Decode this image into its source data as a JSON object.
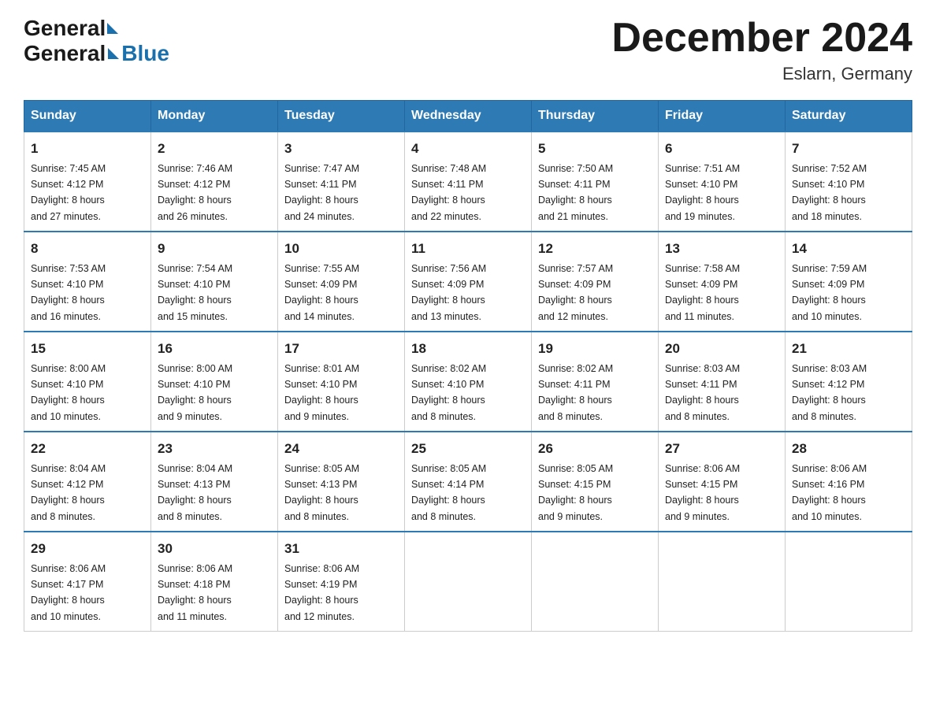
{
  "header": {
    "logo_general": "General",
    "logo_blue": "Blue",
    "month_title": "December 2024",
    "location": "Eslarn, Germany"
  },
  "days_of_week": [
    "Sunday",
    "Monday",
    "Tuesday",
    "Wednesday",
    "Thursday",
    "Friday",
    "Saturday"
  ],
  "weeks": [
    [
      {
        "day": "1",
        "sunrise": "7:45 AM",
        "sunset": "4:12 PM",
        "daylight": "8 hours and 27 minutes."
      },
      {
        "day": "2",
        "sunrise": "7:46 AM",
        "sunset": "4:12 PM",
        "daylight": "8 hours and 26 minutes."
      },
      {
        "day": "3",
        "sunrise": "7:47 AM",
        "sunset": "4:11 PM",
        "daylight": "8 hours and 24 minutes."
      },
      {
        "day": "4",
        "sunrise": "7:48 AM",
        "sunset": "4:11 PM",
        "daylight": "8 hours and 22 minutes."
      },
      {
        "day": "5",
        "sunrise": "7:50 AM",
        "sunset": "4:11 PM",
        "daylight": "8 hours and 21 minutes."
      },
      {
        "day": "6",
        "sunrise": "7:51 AM",
        "sunset": "4:10 PM",
        "daylight": "8 hours and 19 minutes."
      },
      {
        "day": "7",
        "sunrise": "7:52 AM",
        "sunset": "4:10 PM",
        "daylight": "8 hours and 18 minutes."
      }
    ],
    [
      {
        "day": "8",
        "sunrise": "7:53 AM",
        "sunset": "4:10 PM",
        "daylight": "8 hours and 16 minutes."
      },
      {
        "day": "9",
        "sunrise": "7:54 AM",
        "sunset": "4:10 PM",
        "daylight": "8 hours and 15 minutes."
      },
      {
        "day": "10",
        "sunrise": "7:55 AM",
        "sunset": "4:09 PM",
        "daylight": "8 hours and 14 minutes."
      },
      {
        "day": "11",
        "sunrise": "7:56 AM",
        "sunset": "4:09 PM",
        "daylight": "8 hours and 13 minutes."
      },
      {
        "day": "12",
        "sunrise": "7:57 AM",
        "sunset": "4:09 PM",
        "daylight": "8 hours and 12 minutes."
      },
      {
        "day": "13",
        "sunrise": "7:58 AM",
        "sunset": "4:09 PM",
        "daylight": "8 hours and 11 minutes."
      },
      {
        "day": "14",
        "sunrise": "7:59 AM",
        "sunset": "4:09 PM",
        "daylight": "8 hours and 10 minutes."
      }
    ],
    [
      {
        "day": "15",
        "sunrise": "8:00 AM",
        "sunset": "4:10 PM",
        "daylight": "8 hours and 10 minutes."
      },
      {
        "day": "16",
        "sunrise": "8:00 AM",
        "sunset": "4:10 PM",
        "daylight": "8 hours and 9 minutes."
      },
      {
        "day": "17",
        "sunrise": "8:01 AM",
        "sunset": "4:10 PM",
        "daylight": "8 hours and 9 minutes."
      },
      {
        "day": "18",
        "sunrise": "8:02 AM",
        "sunset": "4:10 PM",
        "daylight": "8 hours and 8 minutes."
      },
      {
        "day": "19",
        "sunrise": "8:02 AM",
        "sunset": "4:11 PM",
        "daylight": "8 hours and 8 minutes."
      },
      {
        "day": "20",
        "sunrise": "8:03 AM",
        "sunset": "4:11 PM",
        "daylight": "8 hours and 8 minutes."
      },
      {
        "day": "21",
        "sunrise": "8:03 AM",
        "sunset": "4:12 PM",
        "daylight": "8 hours and 8 minutes."
      }
    ],
    [
      {
        "day": "22",
        "sunrise": "8:04 AM",
        "sunset": "4:12 PM",
        "daylight": "8 hours and 8 minutes."
      },
      {
        "day": "23",
        "sunrise": "8:04 AM",
        "sunset": "4:13 PM",
        "daylight": "8 hours and 8 minutes."
      },
      {
        "day": "24",
        "sunrise": "8:05 AM",
        "sunset": "4:13 PM",
        "daylight": "8 hours and 8 minutes."
      },
      {
        "day": "25",
        "sunrise": "8:05 AM",
        "sunset": "4:14 PM",
        "daylight": "8 hours and 8 minutes."
      },
      {
        "day": "26",
        "sunrise": "8:05 AM",
        "sunset": "4:15 PM",
        "daylight": "8 hours and 9 minutes."
      },
      {
        "day": "27",
        "sunrise": "8:06 AM",
        "sunset": "4:15 PM",
        "daylight": "8 hours and 9 minutes."
      },
      {
        "day": "28",
        "sunrise": "8:06 AM",
        "sunset": "4:16 PM",
        "daylight": "8 hours and 10 minutes."
      }
    ],
    [
      {
        "day": "29",
        "sunrise": "8:06 AM",
        "sunset": "4:17 PM",
        "daylight": "8 hours and 10 minutes."
      },
      {
        "day": "30",
        "sunrise": "8:06 AM",
        "sunset": "4:18 PM",
        "daylight": "8 hours and 11 minutes."
      },
      {
        "day": "31",
        "sunrise": "8:06 AM",
        "sunset": "4:19 PM",
        "daylight": "8 hours and 12 minutes."
      },
      null,
      null,
      null,
      null
    ]
  ],
  "labels": {
    "sunrise": "Sunrise:",
    "sunset": "Sunset:",
    "daylight": "Daylight:"
  }
}
